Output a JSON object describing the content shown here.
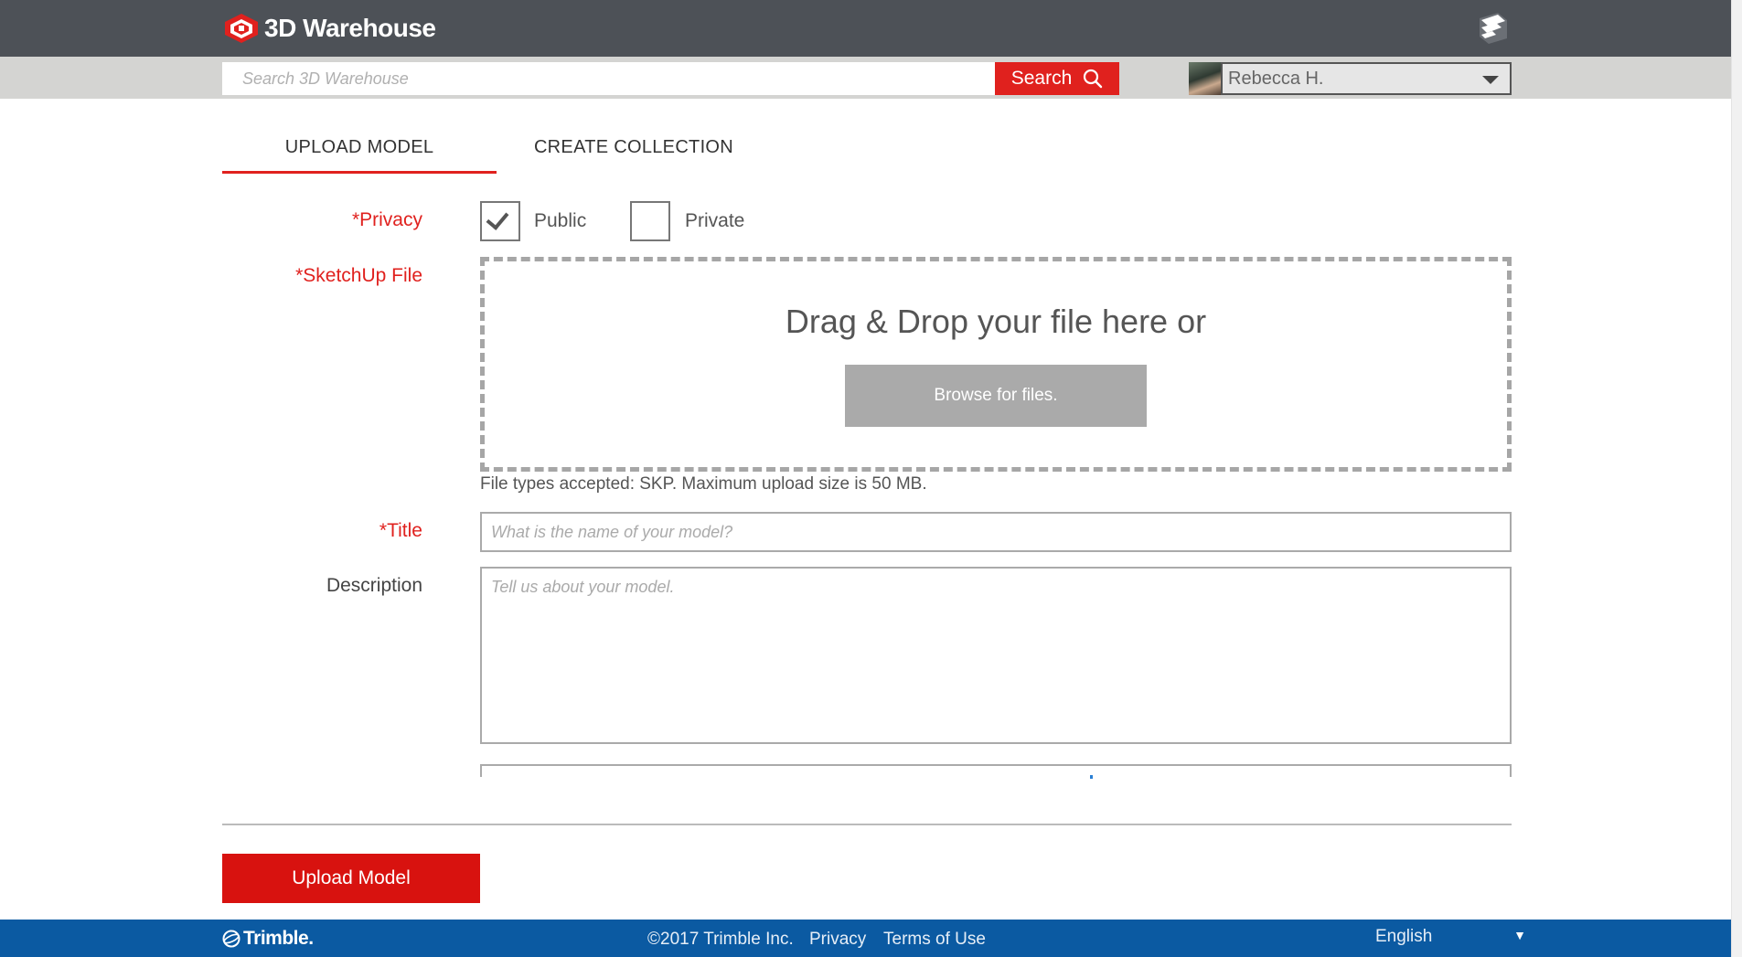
{
  "header": {
    "logo_text": "3D Warehouse"
  },
  "search": {
    "placeholder": "Search 3D Warehouse",
    "button_label": "Search"
  },
  "user": {
    "name": "Rebecca H."
  },
  "tabs": [
    {
      "label": "UPLOAD MODEL",
      "active": true
    },
    {
      "label": "CREATE COLLECTION",
      "active": false
    }
  ],
  "form": {
    "privacy_label": "*Privacy",
    "privacy_options": [
      {
        "label": "Public",
        "checked": true
      },
      {
        "label": "Private",
        "checked": false
      }
    ],
    "file_label": "*SketchUp File",
    "drop_text": "Drag & Drop your file here or",
    "browse_label": "Browse for files.",
    "file_note": "File types accepted: SKP. Maximum upload size is 50 MB.",
    "title_label": "*Title",
    "title_placeholder": "What is the name of your model?",
    "description_label": "Description",
    "description_placeholder": "Tell us about your model.",
    "submit_label": "Upload Model"
  },
  "footer": {
    "brand": "Trimble.",
    "copyright": "©2017 Trimble Inc.",
    "privacy": "Privacy",
    "terms": "Terms of Use",
    "language": "English"
  },
  "colors": {
    "accent_red": "#e0211e",
    "topbar": "#4d5157",
    "footer_blue": "#0b5aa2"
  }
}
